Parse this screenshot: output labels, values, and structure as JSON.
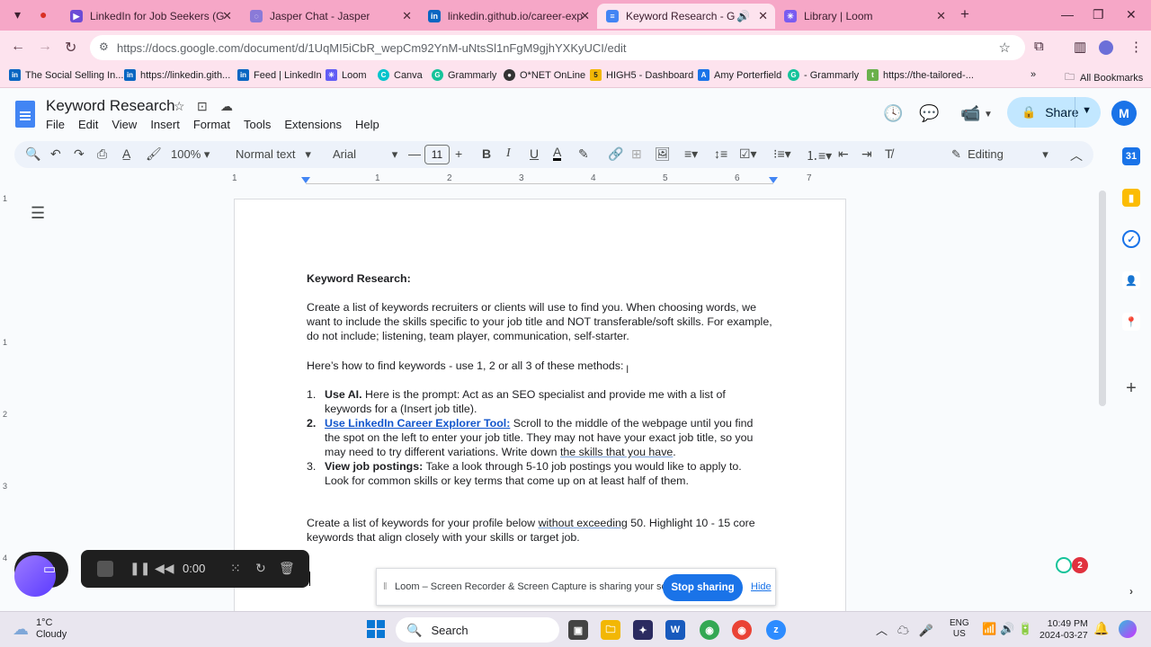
{
  "browser": {
    "tabs": [
      {
        "title": "LinkedIn for Job Seekers (Graph",
        "favicon_color": "#6c4bd6"
      },
      {
        "title": "Jasper Chat - Jasper",
        "favicon_color": "#8a7ad8"
      },
      {
        "title": "linkedin.github.io/career-explo",
        "favicon_color": "#0a66c2"
      },
      {
        "title": "Keyword Research - Google",
        "favicon_color": "#4285f4"
      },
      {
        "title": "Library | Loom",
        "favicon_color": "#7a5cf0"
      }
    ],
    "active_tab_index": 3,
    "url": "https://docs.google.com/document/d/1UqMI5iCbR_wepCm92YnM-uNtsSl1nFgM9gjhYXKyUCI/edit",
    "bookmarks": [
      {
        "label": "The Social Selling In...",
        "color": "#0a66c2",
        "glyph": "in"
      },
      {
        "label": "https://linkedin.gith...",
        "color": "#0a66c2",
        "glyph": "in"
      },
      {
        "label": "Feed | LinkedIn",
        "color": "#0a66c2",
        "glyph": "in"
      },
      {
        "label": "Loom",
        "color": "#625df5",
        "glyph": "✳"
      },
      {
        "label": "Canva",
        "color": "#00c4cc",
        "glyph": "C"
      },
      {
        "label": "Grammarly",
        "color": "#15c39a",
        "glyph": "G"
      },
      {
        "label": "O*NET OnLine",
        "color": "#333333",
        "glyph": "●"
      },
      {
        "label": "HIGH5 - Dashboard",
        "color": "#f2b705",
        "glyph": "5"
      },
      {
        "label": "Amy Porterfield",
        "color": "#1a73e8",
        "glyph": "A"
      },
      {
        "label": "- Grammarly",
        "color": "#15c39a",
        "glyph": "G"
      },
      {
        "label": "https://the-tailored-...",
        "color": "#6ab04c",
        "glyph": "t"
      }
    ],
    "all_bookmarks_label": "All Bookmarks"
  },
  "docs": {
    "title": "Keyword Research",
    "menu": [
      "File",
      "Edit",
      "View",
      "Insert",
      "Format",
      "Tools",
      "Extensions",
      "Help"
    ],
    "share_label": "Share",
    "avatar_letter": "M",
    "toolbar": {
      "zoom": "100%",
      "style": "Normal text",
      "font": "Arial",
      "font_size": "11",
      "mode": "Editing"
    },
    "ruler_numbers": [
      "1",
      "1",
      "2",
      "3",
      "4",
      "5",
      "6",
      "7"
    ],
    "vruler_numbers": [
      "1",
      "1",
      "2",
      "3",
      "4"
    ]
  },
  "document": {
    "heading": "Keyword Research:",
    "intro_lines": [
      "Create a list of keywords recruiters or clients will use to find you. When choosing words, we",
      "want to include the skills specific to your job title and NOT transferable/soft skills. For example,",
      "do not include; listening, team player, communication, self-starter."
    ],
    "howto": "Here’s how to find keywords - use 1, 2 or all 3 of these methods:",
    "steps": [
      {
        "num": "1.",
        "lead": "Use AI.",
        "lines": [
          " Here is the prompt: Act as an SEO specialist and provide me with a list of",
          "keywords for a (Insert job title)."
        ]
      },
      {
        "num": "2.",
        "lead": "Use LinkedIn Career Explorer Tool:",
        "lines": [
          " Scroll to the middle of the webpage until you find",
          "the spot on the left to enter your job title. They may not have your exact job title, so you",
          "may need to try different variations. Write down "
        ],
        "tail_underlined": "the skills that you have",
        "tail_end": "."
      },
      {
        "num": "3.",
        "lead": "View job postings:",
        "lines": [
          " Take a look through 5-10 job postings you would like to apply to.",
          "Look for common skills or key terms that come up on at least half of them."
        ]
      }
    ],
    "closing_line1_pre": "Create a list of keywords for your profile below ",
    "closing_line1_ul": "without exceeding",
    "closing_line1_post": " 50. Highlight 10 - 15 core",
    "closing_line2": "keywords that align closely with your skills or target job."
  },
  "loom": {
    "timer": "0:00",
    "notice": "Loom – Screen Recorder & Screen Capture is sharing your screen.",
    "stop_label": "Stop sharing",
    "hide_label": "Hide"
  },
  "grammarly": {
    "count": "2"
  },
  "taskbar": {
    "temp": "1°C",
    "condition": "Cloudy",
    "search_label": "Search",
    "lang1": "ENG",
    "lang2": "US",
    "time": "10:49 PM",
    "date": "2024-03-27"
  }
}
